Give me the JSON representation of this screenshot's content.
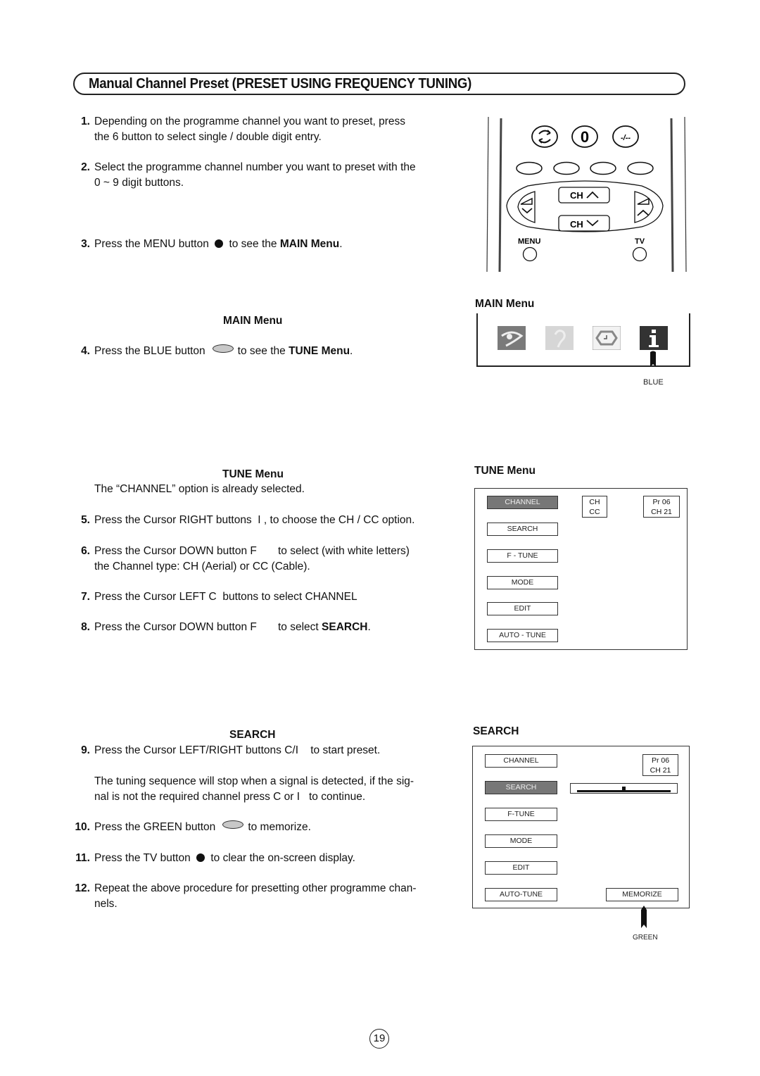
{
  "title": "Manual Channel Preset (PRESET USING FREQUENCY TUNING)",
  "steps": {
    "s1": {
      "num": "1.",
      "line1": "Depending on the programme channel you want to preset, press",
      "line2": "the 6   button to select single / double digit entry."
    },
    "s2": {
      "num": "2.",
      "line1": "Select the programme channel number you want to preset with the",
      "line2": "0 ~ 9 digit buttons."
    },
    "s3": {
      "num": "3.",
      "pre": "Press the MENU button",
      "post": " to see the ",
      "bold": "MAIN Menu",
      "end": "."
    },
    "main_menu_heading": "MAIN Menu",
    "s4": {
      "num": "4.",
      "pre": "Press the BLUE button",
      "post": "to see the ",
      "bold": "TUNE Menu",
      "end": "."
    },
    "tune_menu_heading": "TUNE Menu",
    "tune_note": "The “CHANNEL” option is already selected.",
    "s5": {
      "num": "5.",
      "text": "Press the Cursor RIGHT buttons  I , to choose the CH / CC option."
    },
    "s6": {
      "num": "6.",
      "line1": "Press the Cursor DOWN button F       to select (with white letters)",
      "line2": "the Channel type: CH (Aerial) or CC (Cable)."
    },
    "s7": {
      "num": "7.",
      "text": "Press the Cursor LEFT C  buttons to select CHANNEL"
    },
    "s8": {
      "num": "8.",
      "pre": "Press the Cursor DOWN button F       to select ",
      "bold": "SEARCH",
      "end": "."
    },
    "search_heading": "SEARCH",
    "s9": {
      "num": "9.",
      "text": "Press the Cursor LEFT/RIGHT buttons C/I    to start preset."
    },
    "s9_note": {
      "line1": "The tuning sequence will stop when a signal is detected, if the sig-",
      "line2": "nal is not the required channel press C or I   to continue."
    },
    "s10": {
      "num": "10.",
      "pre": "Press the GREEN button",
      "post": "to memorize."
    },
    "s11": {
      "num": "11.",
      "pre": "Press the TV button",
      "post": " to clear the on-screen display."
    },
    "s12": {
      "num": "12.",
      "line1": "Repeat the above procedure for presetting other programme chan-",
      "line2": "nels."
    }
  },
  "remote": {
    "swap_label": "swap-icon",
    "zero_label": "0",
    "digit_label": "-/--",
    "ch_up_label": "CH",
    "ch_down_label": "CH",
    "menu_label": "MENU",
    "tv_label": "TV"
  },
  "main_menu_panel": {
    "heading": "MAIN Menu",
    "icons": [
      "picture-icon",
      "sound-icon",
      "timer-icon",
      "info-icon"
    ],
    "selected_index": 3,
    "pointer_caption": "BLUE"
  },
  "tune_menu_panel": {
    "heading": "TUNE Menu",
    "options": [
      "CHANNEL",
      "SEARCH",
      "F - TUNE",
      "MODE",
      "EDIT",
      "AUTO - TUNE"
    ],
    "selected": "CHANNEL",
    "channel_type": [
      "CH",
      "CC"
    ],
    "program": "Pr 06",
    "channel": "CH 21"
  },
  "search_panel": {
    "heading": "SEARCH",
    "options": [
      "CHANNEL",
      "SEARCH",
      "F-TUNE",
      "MODE",
      "EDIT",
      "AUTO-TUNE"
    ],
    "selected": "SEARCH",
    "program": "Pr 06",
    "channel": "CH 21",
    "tuning_position": 0.5,
    "memorize_label": "MEMORIZE",
    "pointer_caption": "GREEN"
  },
  "page_number": "19"
}
